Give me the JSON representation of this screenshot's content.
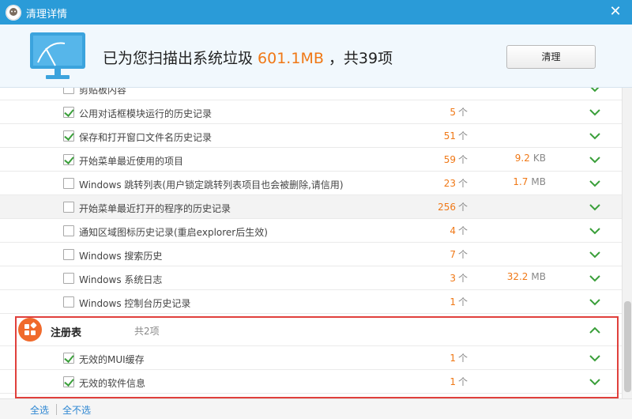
{
  "window": {
    "title": "清理详情",
    "close_glyph": "✕"
  },
  "header": {
    "summary_prefix": "已为您扫描出系统垃圾 ",
    "summary_size": "601.1MB",
    "summary_suffix": " ，共39项",
    "clean_button": "清理"
  },
  "list": {
    "partial_row": {
      "label": "剪贴板内容",
      "checked": false
    },
    "rows": [
      {
        "label": "公用对话框模块运行的历史记录",
        "count": "5",
        "count_unit": "个",
        "size": "",
        "size_unit": "",
        "checked": true
      },
      {
        "label": "保存和打开窗口文件名历史记录",
        "count": "51",
        "count_unit": "个",
        "size": "",
        "size_unit": "",
        "checked": true
      },
      {
        "label": "开始菜单最近使用的项目",
        "count": "59",
        "count_unit": "个",
        "size": "9.2",
        "size_unit": "KB",
        "checked": true
      },
      {
        "label": "Windows 跳转列表(用户锁定跳转列表项目也会被删除,请信用)",
        "count": "23",
        "count_unit": "个",
        "size": "1.7",
        "size_unit": "MB",
        "checked": false
      },
      {
        "label": "开始菜单最近打开的程序的历史记录",
        "count": "256",
        "count_unit": "个",
        "size": "",
        "size_unit": "",
        "checked": false
      },
      {
        "label": "通知区域图标历史记录(重启explorer后生效)",
        "count": "4",
        "count_unit": "个",
        "size": "",
        "size_unit": "",
        "checked": false
      },
      {
        "label": "Windows 搜索历史",
        "count": "7",
        "count_unit": "个",
        "size": "",
        "size_unit": "",
        "checked": false
      },
      {
        "label": "Windows 系统日志",
        "count": "3",
        "count_unit": "个",
        "size": "32.2",
        "size_unit": "MB",
        "checked": false
      },
      {
        "label": "Windows 控制台历史记录",
        "count": "1",
        "count_unit": "个",
        "size": "",
        "size_unit": "",
        "checked": false
      }
    ],
    "category": {
      "title": "注册表",
      "count": "共2项",
      "icon": "registry-icon"
    },
    "category_rows": [
      {
        "label": "无效的MUI缓存",
        "count": "1",
        "count_unit": "个",
        "checked": true
      },
      {
        "label": "无效的软件信息",
        "count": "1",
        "count_unit": "个",
        "checked": true
      }
    ]
  },
  "footer": {
    "select_all": "全选",
    "select_none": "全不选"
  },
  "colors": {
    "accent": "#2a9bd8",
    "highlight_number": "#f07816",
    "check": "#3a9f3a",
    "chevron": "#3a9f3a",
    "box": "#e0403c"
  }
}
